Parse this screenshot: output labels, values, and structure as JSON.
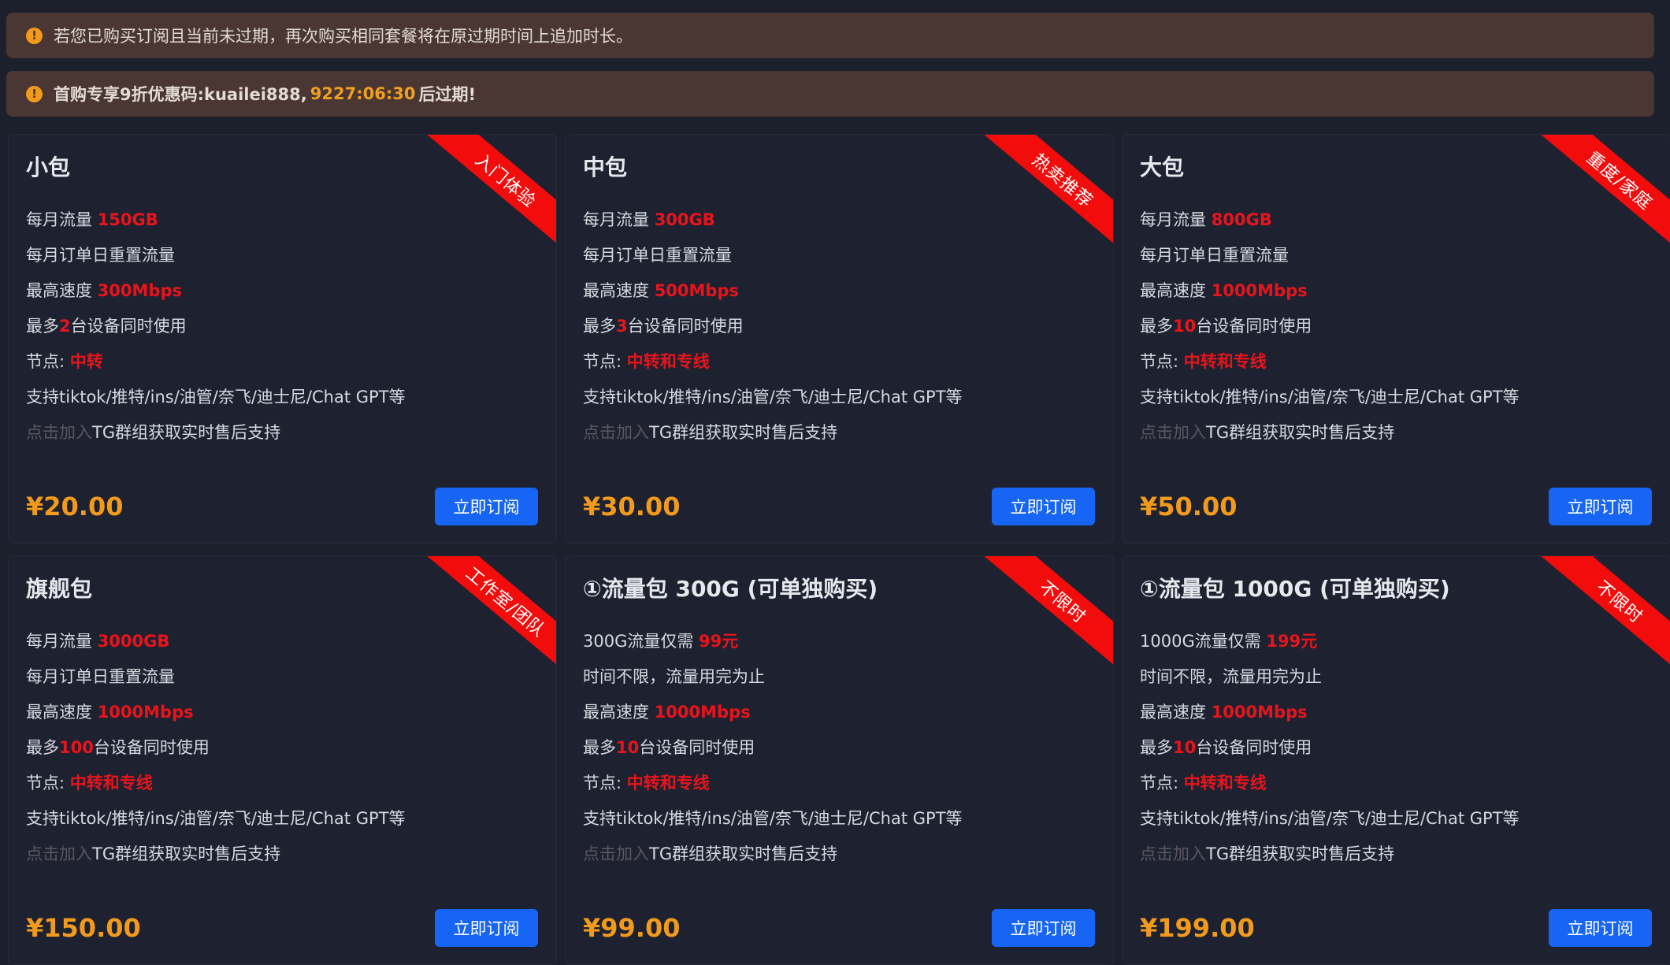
{
  "notices": {
    "info": "若您已购买订阅且当前未过期，再次购买相同套餐将在原过期时间上追加时长。",
    "promo_prefix": "首购专享9折优惠码:kuailei888,",
    "promo_timer": "9227:06:30",
    "promo_suffix": "后过期!",
    "icon": "!"
  },
  "buy_label": "立即订阅",
  "plans": [
    {
      "name": "小包",
      "ribbon": "入门体验",
      "f1_pre": "每月流量 ",
      "f1_val": "150GB",
      "f2": "每月订单日重置流量",
      "f3_pre": "最高速度 ",
      "f3_val": "300Mbps",
      "f4_pre": "最多",
      "f4_val": "2",
      "f4_post": "台设备同时使用",
      "f5_pre": "节点:  ",
      "f5_val": "中转",
      "f6": "支持tiktok/推特/ins/油管/奈飞/迪士尼/Chat GPT等",
      "f7_link": "点击加入",
      "f7_post": "TG群组获取实时售后支持",
      "price": "¥20.00"
    },
    {
      "name": "中包",
      "ribbon": "热卖推荐",
      "f1_pre": "每月流量 ",
      "f1_val": "300GB",
      "f2": "每月订单日重置流量",
      "f3_pre": "最高速度 ",
      "f3_val": "500Mbps",
      "f4_pre": "最多",
      "f4_val": "3",
      "f4_post": "台设备同时使用",
      "f5_pre": "节点:  ",
      "f5_val": "中转和专线",
      "f6": "支持tiktok/推特/ins/油管/奈飞/迪士尼/Chat GPT等",
      "f7_link": "点击加入",
      "f7_post": "TG群组获取实时售后支持",
      "price": "¥30.00"
    },
    {
      "name": "大包",
      "ribbon": "重度/家庭",
      "f1_pre": "每月流量 ",
      "f1_val": "800GB",
      "f2": "每月订单日重置流量",
      "f3_pre": "最高速度 ",
      "f3_val": "1000Mbps",
      "f4_pre": "最多",
      "f4_val": "10",
      "f4_post": "台设备同时使用",
      "f5_pre": "节点:  ",
      "f5_val": "中转和专线",
      "f6": "支持tiktok/推特/ins/油管/奈飞/迪士尼/Chat GPT等",
      "f7_link": "点击加入",
      "f7_post": "TG群组获取实时售后支持",
      "price": "¥50.00"
    },
    {
      "name": "旗舰包",
      "ribbon": "工作室/团队",
      "f1_pre": "每月流量 ",
      "f1_val": "3000GB",
      "f2": "每月订单日重置流量",
      "f3_pre": "最高速度 ",
      "f3_val": "1000Mbps",
      "f4_pre": "最多",
      "f4_val": "100",
      "f4_post": "台设备同时使用",
      "f5_pre": "节点:  ",
      "f5_val": "中转和专线",
      "f6": "支持tiktok/推特/ins/油管/奈飞/迪士尼/Chat GPT等",
      "f7_link": "点击加入",
      "f7_post": "TG群组获取实时售后支持",
      "price": "¥150.00"
    },
    {
      "name": "①流量包 300G (可单独购买)",
      "ribbon": "不限时",
      "f1_pre": "300G流量仅需 ",
      "f1_val": "99元",
      "f2": "时间不限，流量用完为止",
      "f3_pre": "最高速度 ",
      "f3_val": "1000Mbps",
      "f4_pre": "最多",
      "f4_val": "10",
      "f4_post": "台设备同时使用",
      "f5_pre": "节点:  ",
      "f5_val": "中转和专线",
      "f6": "支持tiktok/推特/ins/油管/奈飞/迪士尼/Chat GPT等",
      "f7_link": "点击加入",
      "f7_post": "TG群组获取实时售后支持",
      "price": "¥99.00"
    },
    {
      "name": "①流量包 1000G (可单独购买)",
      "ribbon": "不限时",
      "f1_pre": "1000G流量仅需 ",
      "f1_val": "199元",
      "f2": "时间不限，流量用完为止",
      "f3_pre": "最高速度 ",
      "f3_val": "1000Mbps",
      "f4_pre": "最多",
      "f4_val": "10",
      "f4_post": "台设备同时使用",
      "f5_pre": "节点:  ",
      "f5_val": "中转和专线",
      "f6": "支持tiktok/推特/ins/油管/奈飞/迪士尼/Chat GPT等",
      "f7_link": "点击加入",
      "f7_post": "TG群组获取实时售后支持",
      "price": "¥199.00"
    }
  ]
}
